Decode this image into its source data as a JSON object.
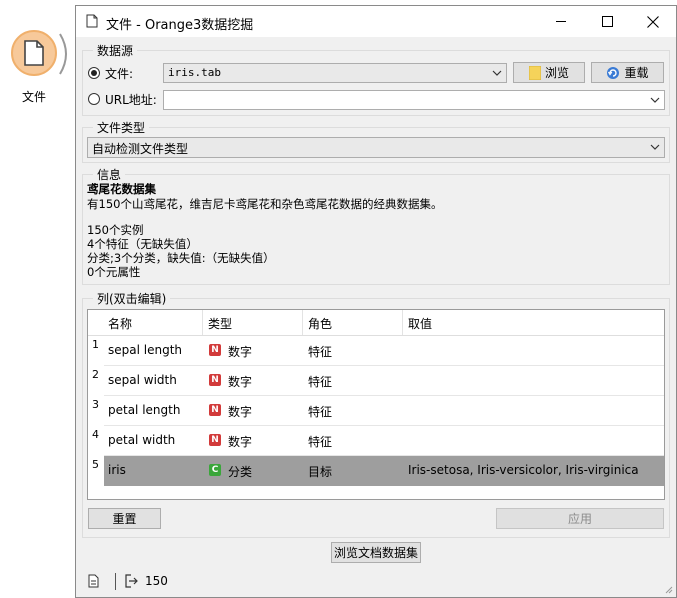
{
  "canvas": {
    "widget_label": "文件"
  },
  "window": {
    "title": "文件 - Orange3数据挖掘"
  },
  "source": {
    "group_title": "数据源",
    "file_label": "文件:",
    "file_value": "iris.tab",
    "browse_label": "浏览",
    "reload_label": "重载",
    "url_label": "URL地址:",
    "url_value": ""
  },
  "file_type": {
    "group_title": "文件类型",
    "selected": "自动检测文件类型"
  },
  "info": {
    "group_title": "信息",
    "dataset_title": "鸢尾花数据集",
    "description": "有150个山鸢尾花，维吉尼卡鸢尾花和杂色鸢尾花数据的经典数据集。",
    "instances": "150个实例",
    "features": "4个特征（无缺失值）",
    "target": "分类;3个分类，缺失值:（无缺失值）",
    "meta": "0个元属性"
  },
  "columns": {
    "group_title": "列(双击编辑)",
    "headers": [
      "名称",
      "类型",
      "角色",
      "取值"
    ],
    "rows": [
      {
        "index": "1",
        "name": "sepal length",
        "type_badge": "N",
        "type": "数字",
        "role": "特征",
        "values": ""
      },
      {
        "index": "2",
        "name": "sepal width",
        "type_badge": "N",
        "type": "数字",
        "role": "特征",
        "values": ""
      },
      {
        "index": "3",
        "name": "petal length",
        "type_badge": "N",
        "type": "数字",
        "role": "特征",
        "values": ""
      },
      {
        "index": "4",
        "name": "petal width",
        "type_badge": "N",
        "type": "数字",
        "role": "特征",
        "values": ""
      },
      {
        "index": "5",
        "name": "iris",
        "type_badge": "C",
        "type": "分类",
        "role": "目标",
        "values": "Iris-setosa, Iris-versicolor, Iris-virginica"
      }
    ],
    "reset_label": "重置",
    "apply_label": "应用"
  },
  "browse_docs_label": "浏览文档数据集",
  "status": {
    "output_count": "150"
  },
  "colors": {
    "widget_fill": "#f7c99a",
    "numeric_badge": "#d23a3a",
    "categorical_badge": "#3aa63a",
    "selected_row": "#9e9e9e"
  }
}
